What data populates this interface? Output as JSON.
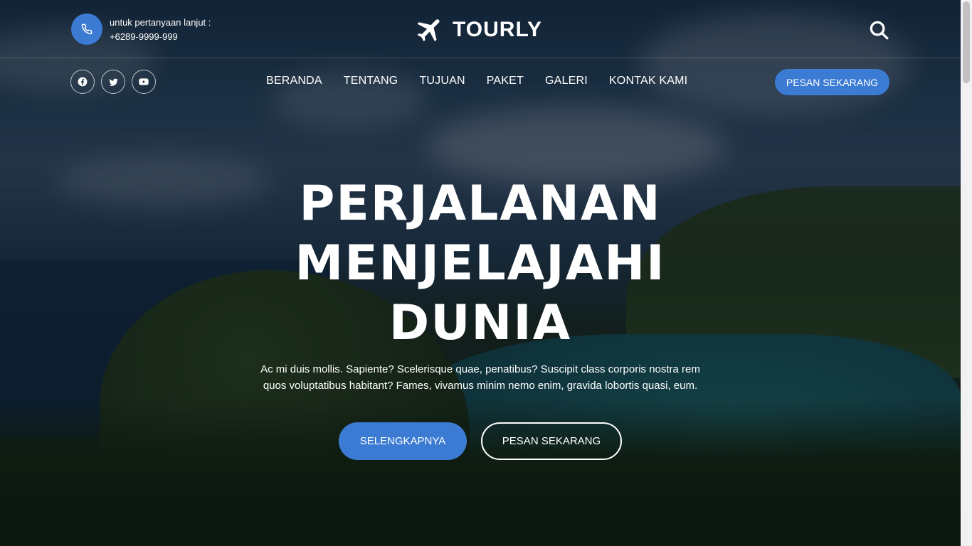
{
  "contact": {
    "label": "untuk pertanyaan lanjut :",
    "phone": "+6289-9999-999",
    "icon": "phone-icon"
  },
  "brand": {
    "name": "TOURLY",
    "icon": "plane-icon"
  },
  "header": {
    "search_icon": "search-icon"
  },
  "social": [
    {
      "name": "facebook",
      "icon": "facebook-icon"
    },
    {
      "name": "twitter",
      "icon": "twitter-icon"
    },
    {
      "name": "youtube",
      "icon": "youtube-icon"
    }
  ],
  "nav": {
    "items": [
      "BERANDA",
      "TENTANG",
      "TUJUAN",
      "PAKET",
      "GALERI",
      "KONTAK KAMI"
    ],
    "book_label": "PESAN SEKARANG"
  },
  "hero": {
    "title_line1": "PERJALANAN",
    "title_line2": "MENJELAJAHI",
    "title_line3": "DUNIA",
    "desc_line1": "Ac mi duis mollis. Sapiente? Scelerisque quae, penatibus? Suscipit class corporis nostra rem",
    "desc_line2": "quos voluptatibus habitant? Fames, vivamus minim nemo enim, gravida lobortis quasi, eum.",
    "more_label": "SELENGKAPNYA",
    "book_label": "PESAN SEKARANG"
  },
  "colors": {
    "accent": "#3b7bd4",
    "text": "#ffffff"
  }
}
